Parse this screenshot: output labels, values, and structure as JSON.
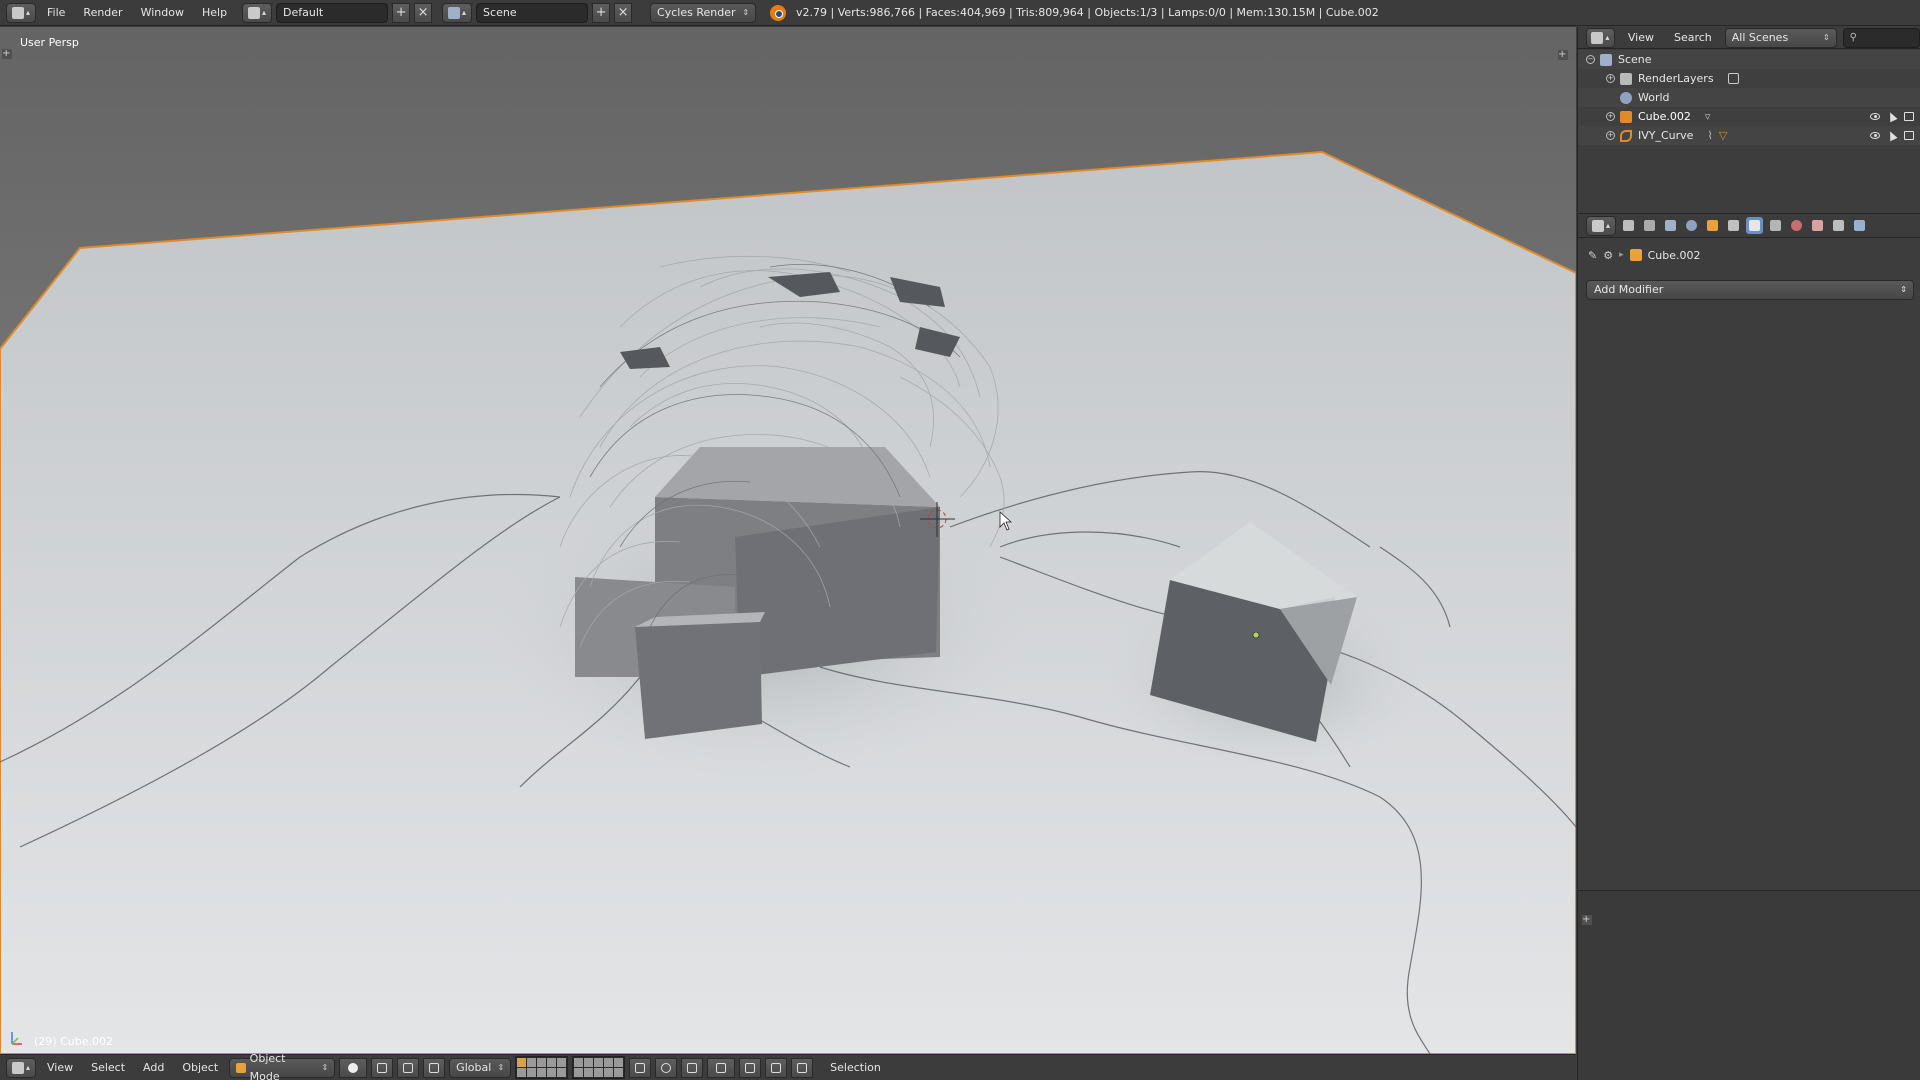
{
  "top_header": {
    "menus": [
      "File",
      "Render",
      "Window",
      "Help"
    ],
    "screen_layout": "Default",
    "scene": "Scene",
    "render_engine": "Cycles Render",
    "stats": "v2.79 | Verts:986,766 | Faces:404,969 | Tris:809,964 | Objects:1/3 | Lamps:0/0 | Mem:130.15M | Cube.002"
  },
  "viewport": {
    "view_label": "User Persp",
    "object_label": "(29) Cube.002"
  },
  "bottom_header": {
    "menus": [
      "View",
      "Select",
      "Add",
      "Object"
    ],
    "mode": "Object Mode",
    "orientation": "Global",
    "selection_label": "Selection"
  },
  "outliner": {
    "menus": [
      "View",
      "Search"
    ],
    "scope": "All Scenes",
    "rows": [
      {
        "label": "Scene",
        "icon": "scene-icon"
      },
      {
        "label": "RenderLayers",
        "icon": "render-layers-icon"
      },
      {
        "label": "World",
        "icon": "world-icon"
      },
      {
        "label": "Cube.002",
        "icon": "mesh-icon"
      },
      {
        "label": "IVY_Curve",
        "icon": "curve-icon"
      }
    ]
  },
  "properties": {
    "object_name": "Cube.002",
    "add_modifier_label": "Add Modifier",
    "active_tab": "modifier-tab",
    "tabs": [
      "render-tab",
      "render-layers-tab",
      "scene-tab",
      "world-tab",
      "object-tab",
      "constraints-tab",
      "modifier-tab",
      "data-tab",
      "material-tab",
      "texture-tab",
      "particles-tab",
      "physics-tab"
    ]
  },
  "colors": {
    "accent_selected": "#e87d0d",
    "active_tab": "#6b8fc4",
    "panel_bg": "#3d3d3d"
  }
}
